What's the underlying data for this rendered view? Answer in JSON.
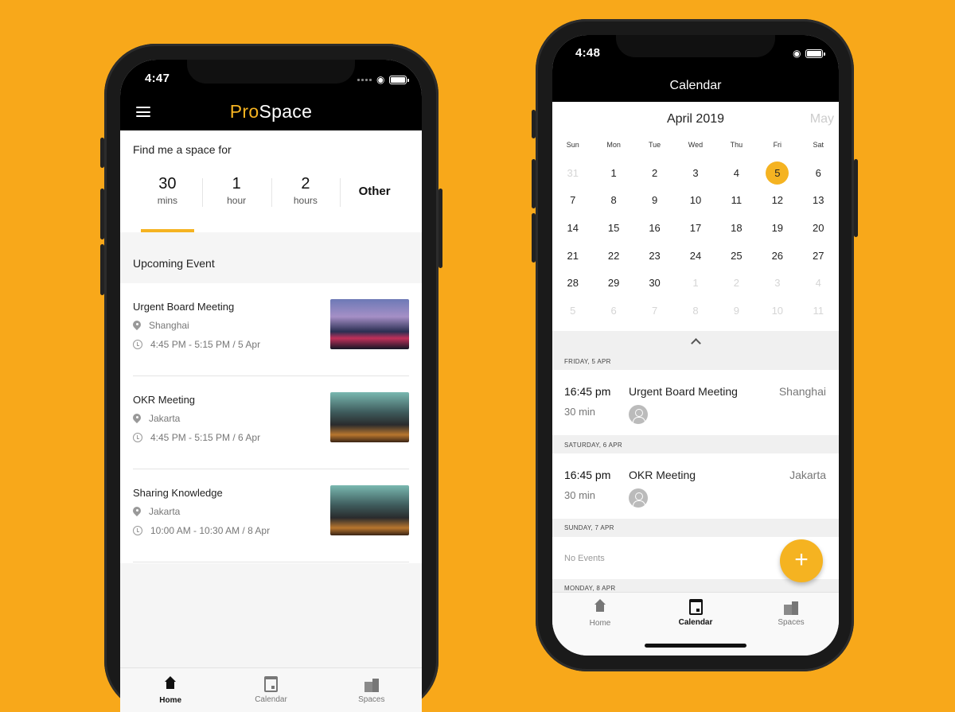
{
  "left_phone": {
    "status_time": "4:47",
    "logo": {
      "pro": "Pro",
      "space": "Space"
    },
    "find_label": "Find me a space for",
    "durations": [
      {
        "value": "30",
        "unit": "mins",
        "selected": true
      },
      {
        "value": "1",
        "unit": "hour"
      },
      {
        "value": "2",
        "unit": "hours"
      },
      {
        "value": "Other",
        "unit": ""
      }
    ],
    "upcoming_label": "Upcoming Event",
    "events": [
      {
        "title": "Urgent Board Meeting",
        "location": "Shanghai",
        "time": "4:45 PM - 5:15 PM / 5 Apr"
      },
      {
        "title": "OKR Meeting",
        "location": "Jakarta",
        "time": "4:45 PM - 5:15 PM / 6 Apr"
      },
      {
        "title": "Sharing Knowledge",
        "location": "Jakarta",
        "time": "10:00 AM - 10:30 AM / 8 Apr"
      }
    ],
    "tabs": [
      {
        "label": "Home",
        "icon": "home-icon",
        "active": true
      },
      {
        "label": "Calendar",
        "icon": "calendar-icon"
      },
      {
        "label": "Spaces",
        "icon": "building-icon"
      }
    ]
  },
  "right_phone": {
    "status_time": "4:48",
    "title": "Calendar",
    "month": "April 2019",
    "next_month": "May",
    "weekdays": [
      "Sun",
      "Mon",
      "Tue",
      "Wed",
      "Thu",
      "Fri",
      "Sat"
    ],
    "weeks": [
      [
        "31",
        "1",
        "2",
        "3",
        "4",
        "5",
        "6"
      ],
      [
        "7",
        "8",
        "9",
        "10",
        "11",
        "12",
        "13"
      ],
      [
        "14",
        "15",
        "16",
        "17",
        "18",
        "19",
        "20"
      ],
      [
        "21",
        "22",
        "23",
        "24",
        "25",
        "26",
        "27"
      ],
      [
        "28",
        "29",
        "30",
        "1",
        "2",
        "3",
        "4"
      ],
      [
        "5",
        "6",
        "7",
        "8",
        "9",
        "10",
        "11"
      ]
    ],
    "selected_day": "5",
    "agenda": [
      {
        "header": "FRIDAY, 5 APR",
        "time": "16:45 pm",
        "duration": "30 min",
        "title": "Urgent Board Meeting",
        "location": "Shanghai"
      },
      {
        "header": "SATURDAY, 6 APR",
        "time": "16:45 pm",
        "duration": "30 min",
        "title": "OKR Meeting",
        "location": "Jakarta"
      },
      {
        "header": "SUNDAY, 7 APR",
        "no_events": "No Events"
      },
      {
        "header": "MONDAY, 8 APR"
      }
    ],
    "fab": "+",
    "tabs": [
      {
        "label": "Home",
        "icon": "home-icon"
      },
      {
        "label": "Calendar",
        "icon": "calendar-icon",
        "active": true
      },
      {
        "label": "Spaces",
        "icon": "building-icon"
      }
    ]
  },
  "colors": {
    "background": "#f8a81a",
    "accent": "#f5b321",
    "bar": "#000000"
  }
}
